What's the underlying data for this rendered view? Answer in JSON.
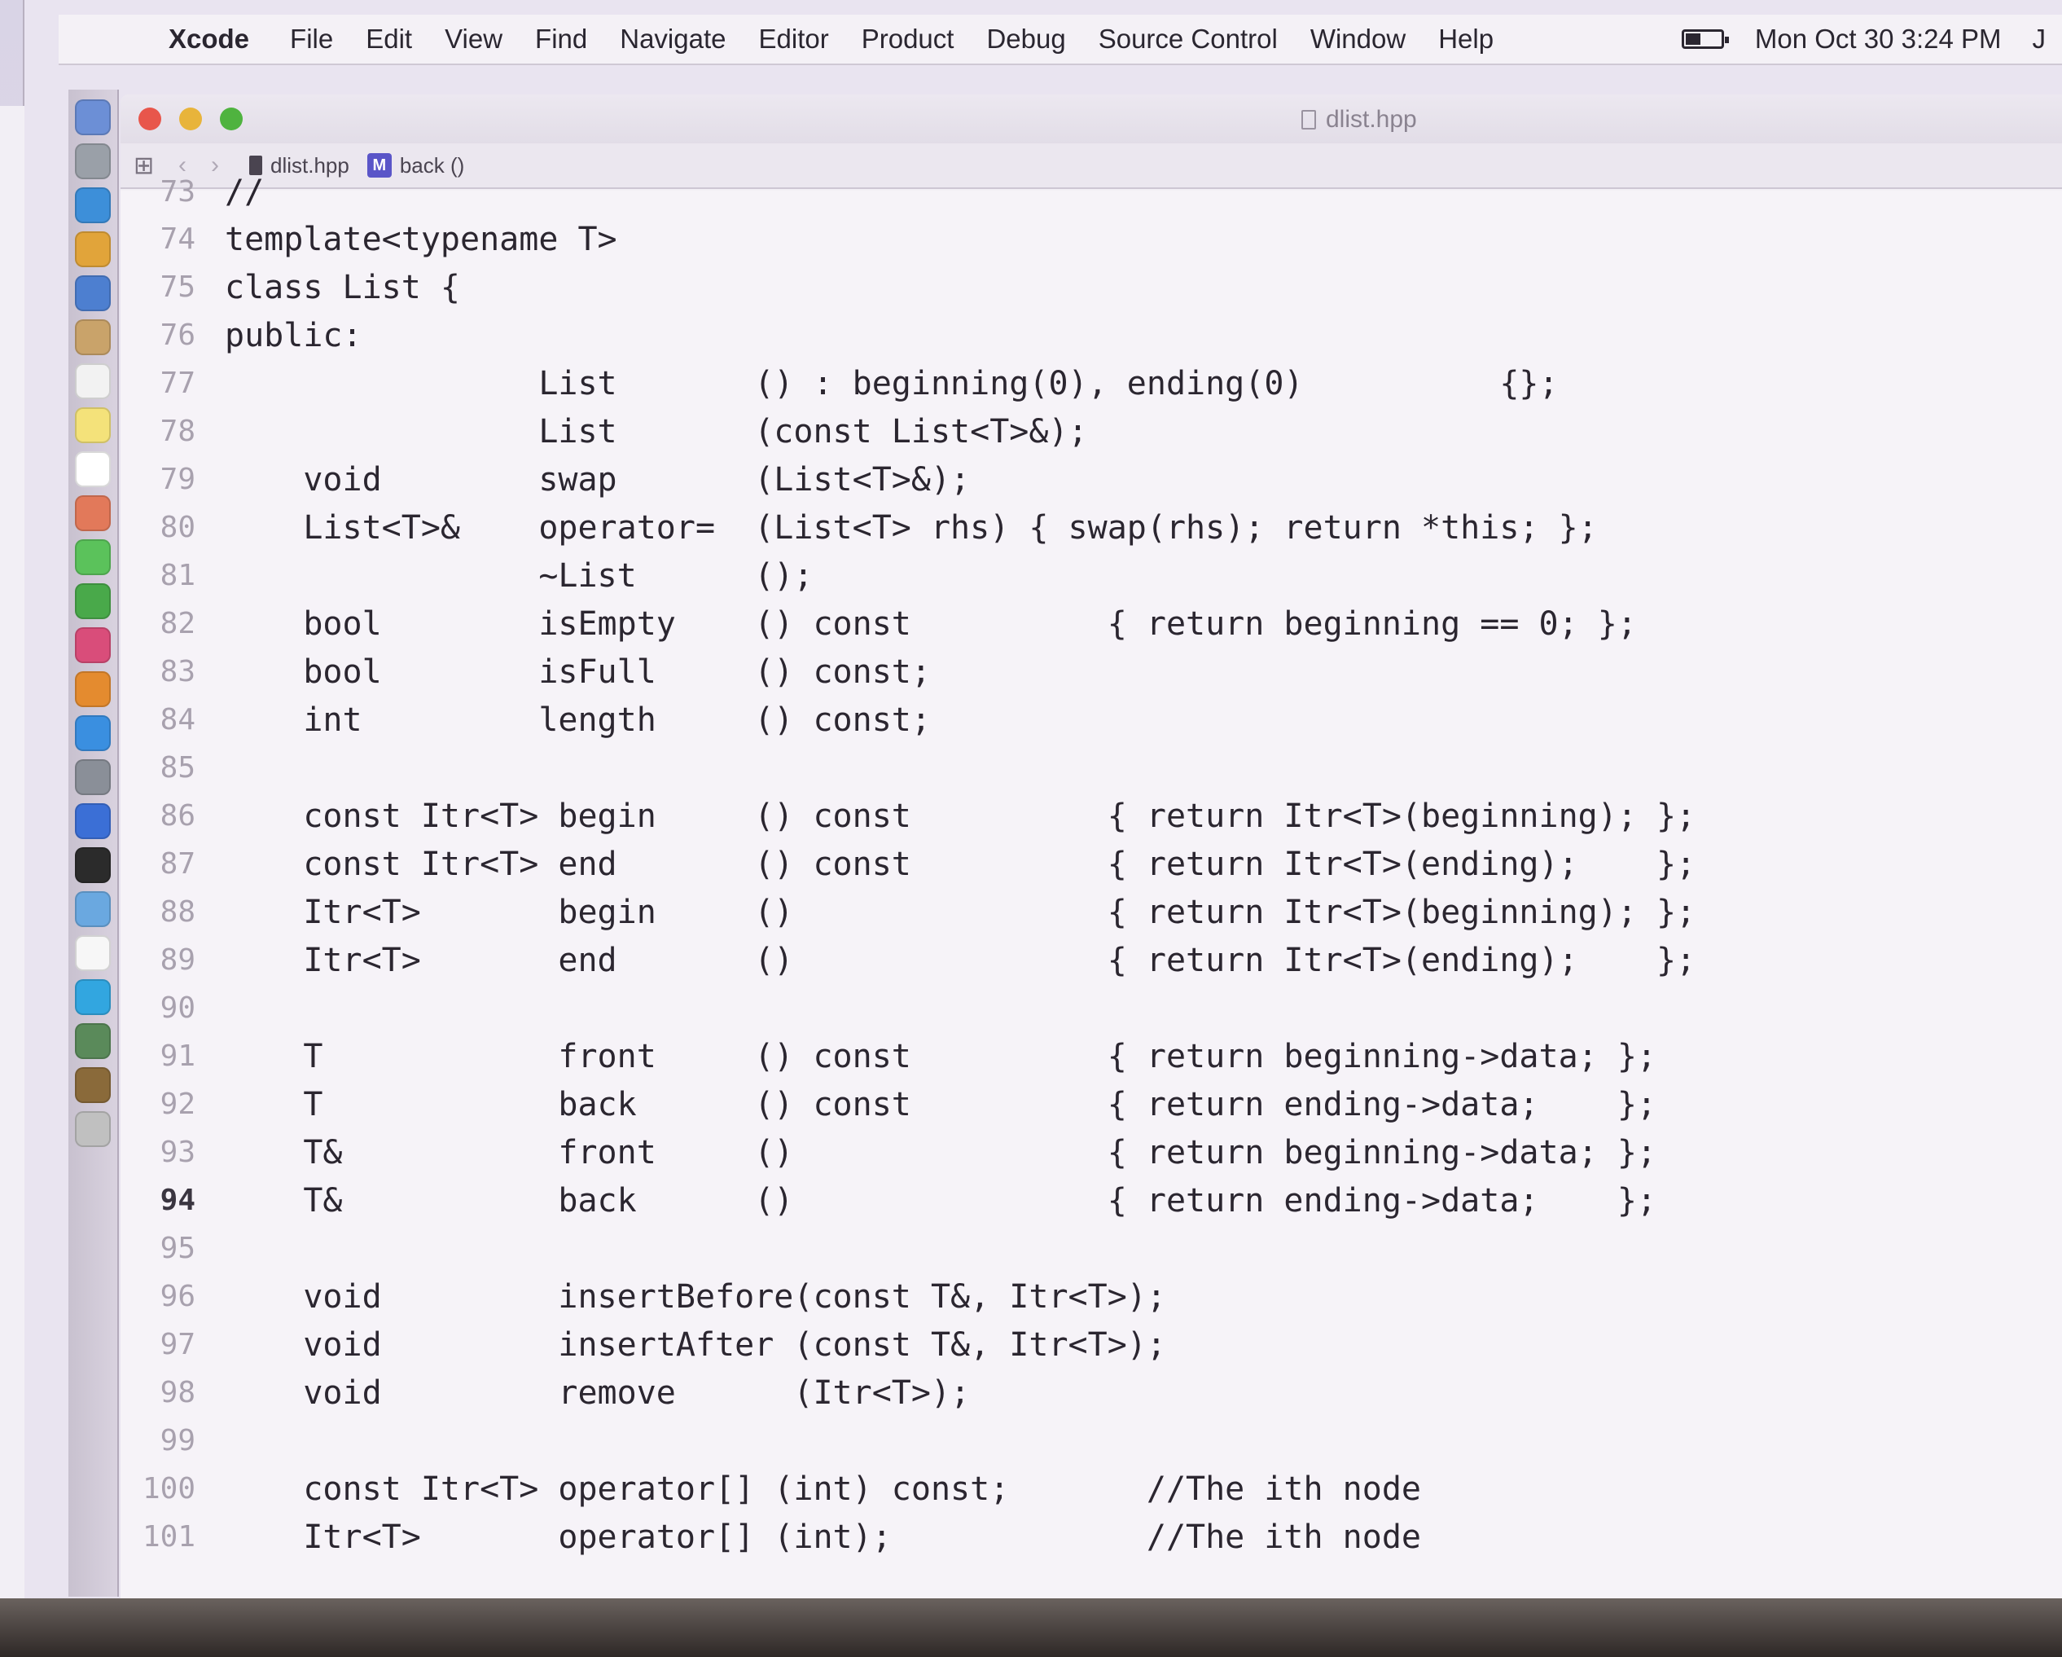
{
  "menubar": {
    "app_name": "Xcode",
    "items": [
      "File",
      "Edit",
      "View",
      "Find",
      "Navigate",
      "Editor",
      "Product",
      "Debug",
      "Source Control",
      "Window",
      "Help"
    ],
    "clock": "Mon Oct 30  3:24 PM",
    "trailing": "J"
  },
  "window": {
    "title": "dlist.hpp"
  },
  "jumpbar": {
    "file": "dlist.hpp",
    "symbol_badge": "M",
    "symbol": "back ()"
  },
  "editor": {
    "partial_top": {
      "number": "73",
      "text": "//"
    },
    "lines": [
      {
        "number": "74",
        "text": "template<typename T>"
      },
      {
        "number": "75",
        "text": "class List {"
      },
      {
        "number": "76",
        "text": "public:"
      },
      {
        "number": "77",
        "text": "                List       () : beginning(0), ending(0)          {};"
      },
      {
        "number": "78",
        "text": "                List       (const List<T>&);"
      },
      {
        "number": "79",
        "text": "    void        swap       (List<T>&);"
      },
      {
        "number": "80",
        "text": "    List<T>&    operator=  (List<T> rhs) { swap(rhs); return *this; };"
      },
      {
        "number": "81",
        "text": "                ~List      ();"
      },
      {
        "number": "82",
        "text": "    bool        isEmpty    () const          { return beginning == 0; };"
      },
      {
        "number": "83",
        "text": "    bool        isFull     () const;"
      },
      {
        "number": "84",
        "text": "    int         length     () const;"
      },
      {
        "number": "85",
        "text": ""
      },
      {
        "number": "86",
        "text": "    const Itr<T> begin     () const          { return Itr<T>(beginning); };"
      },
      {
        "number": "87",
        "text": "    const Itr<T> end       () const          { return Itr<T>(ending);    };"
      },
      {
        "number": "88",
        "text": "    Itr<T>       begin     ()                { return Itr<T>(beginning); };"
      },
      {
        "number": "89",
        "text": "    Itr<T>       end       ()                { return Itr<T>(ending);    };"
      },
      {
        "number": "90",
        "text": ""
      },
      {
        "number": "91",
        "text": "    T            front     () const          { return beginning->data; };"
      },
      {
        "number": "92",
        "text": "    T            back      () const          { return ending->data;    };"
      },
      {
        "number": "93",
        "text": "    T&           front     ()                { return beginning->data; };"
      },
      {
        "number": "94",
        "text": "    T&           back      ()                { return ending->data;    };"
      },
      {
        "number": "95",
        "text": ""
      },
      {
        "number": "96",
        "text": "    void         insertBefore(const T&, Itr<T>);"
      },
      {
        "number": "97",
        "text": "    void         insertAfter (const T&, Itr<T>);"
      },
      {
        "number": "98",
        "text": "    void         remove      (Itr<T>);"
      },
      {
        "number": "99",
        "text": ""
      },
      {
        "number": "100",
        "text": "    const Itr<T> operator[] (int) const;       //The ith node"
      },
      {
        "number": "101",
        "text": "    Itr<T>       operator[] (int);             //The ith node"
      }
    ],
    "current_line": "94"
  },
  "colors": {
    "editor_bg": "#f6f3f8",
    "gutter_text": "#a8a1ae",
    "code_text": "#2b2630",
    "number_literal": "#2b3fa0",
    "close": "#e8564b",
    "minimize": "#e8b43b",
    "zoom": "#4fb33f"
  },
  "dock_icons": [
    "finder-icon",
    "launchpad-icon",
    "safari-icon",
    "chrome-icon",
    "mail-icon",
    "contacts-icon",
    "calendar-icon",
    "notes-icon",
    "reminders-icon",
    "photos-icon",
    "messages-icon",
    "facetime-icon",
    "itunes-icon",
    "ibooks-icon",
    "app-store-icon",
    "system-preferences-icon",
    "xcode-icon",
    "terminal-icon",
    "preview-icon",
    "textedit-icon",
    "skype-icon",
    "time-machine-icon",
    "archive-icon",
    "trash-icon"
  ]
}
